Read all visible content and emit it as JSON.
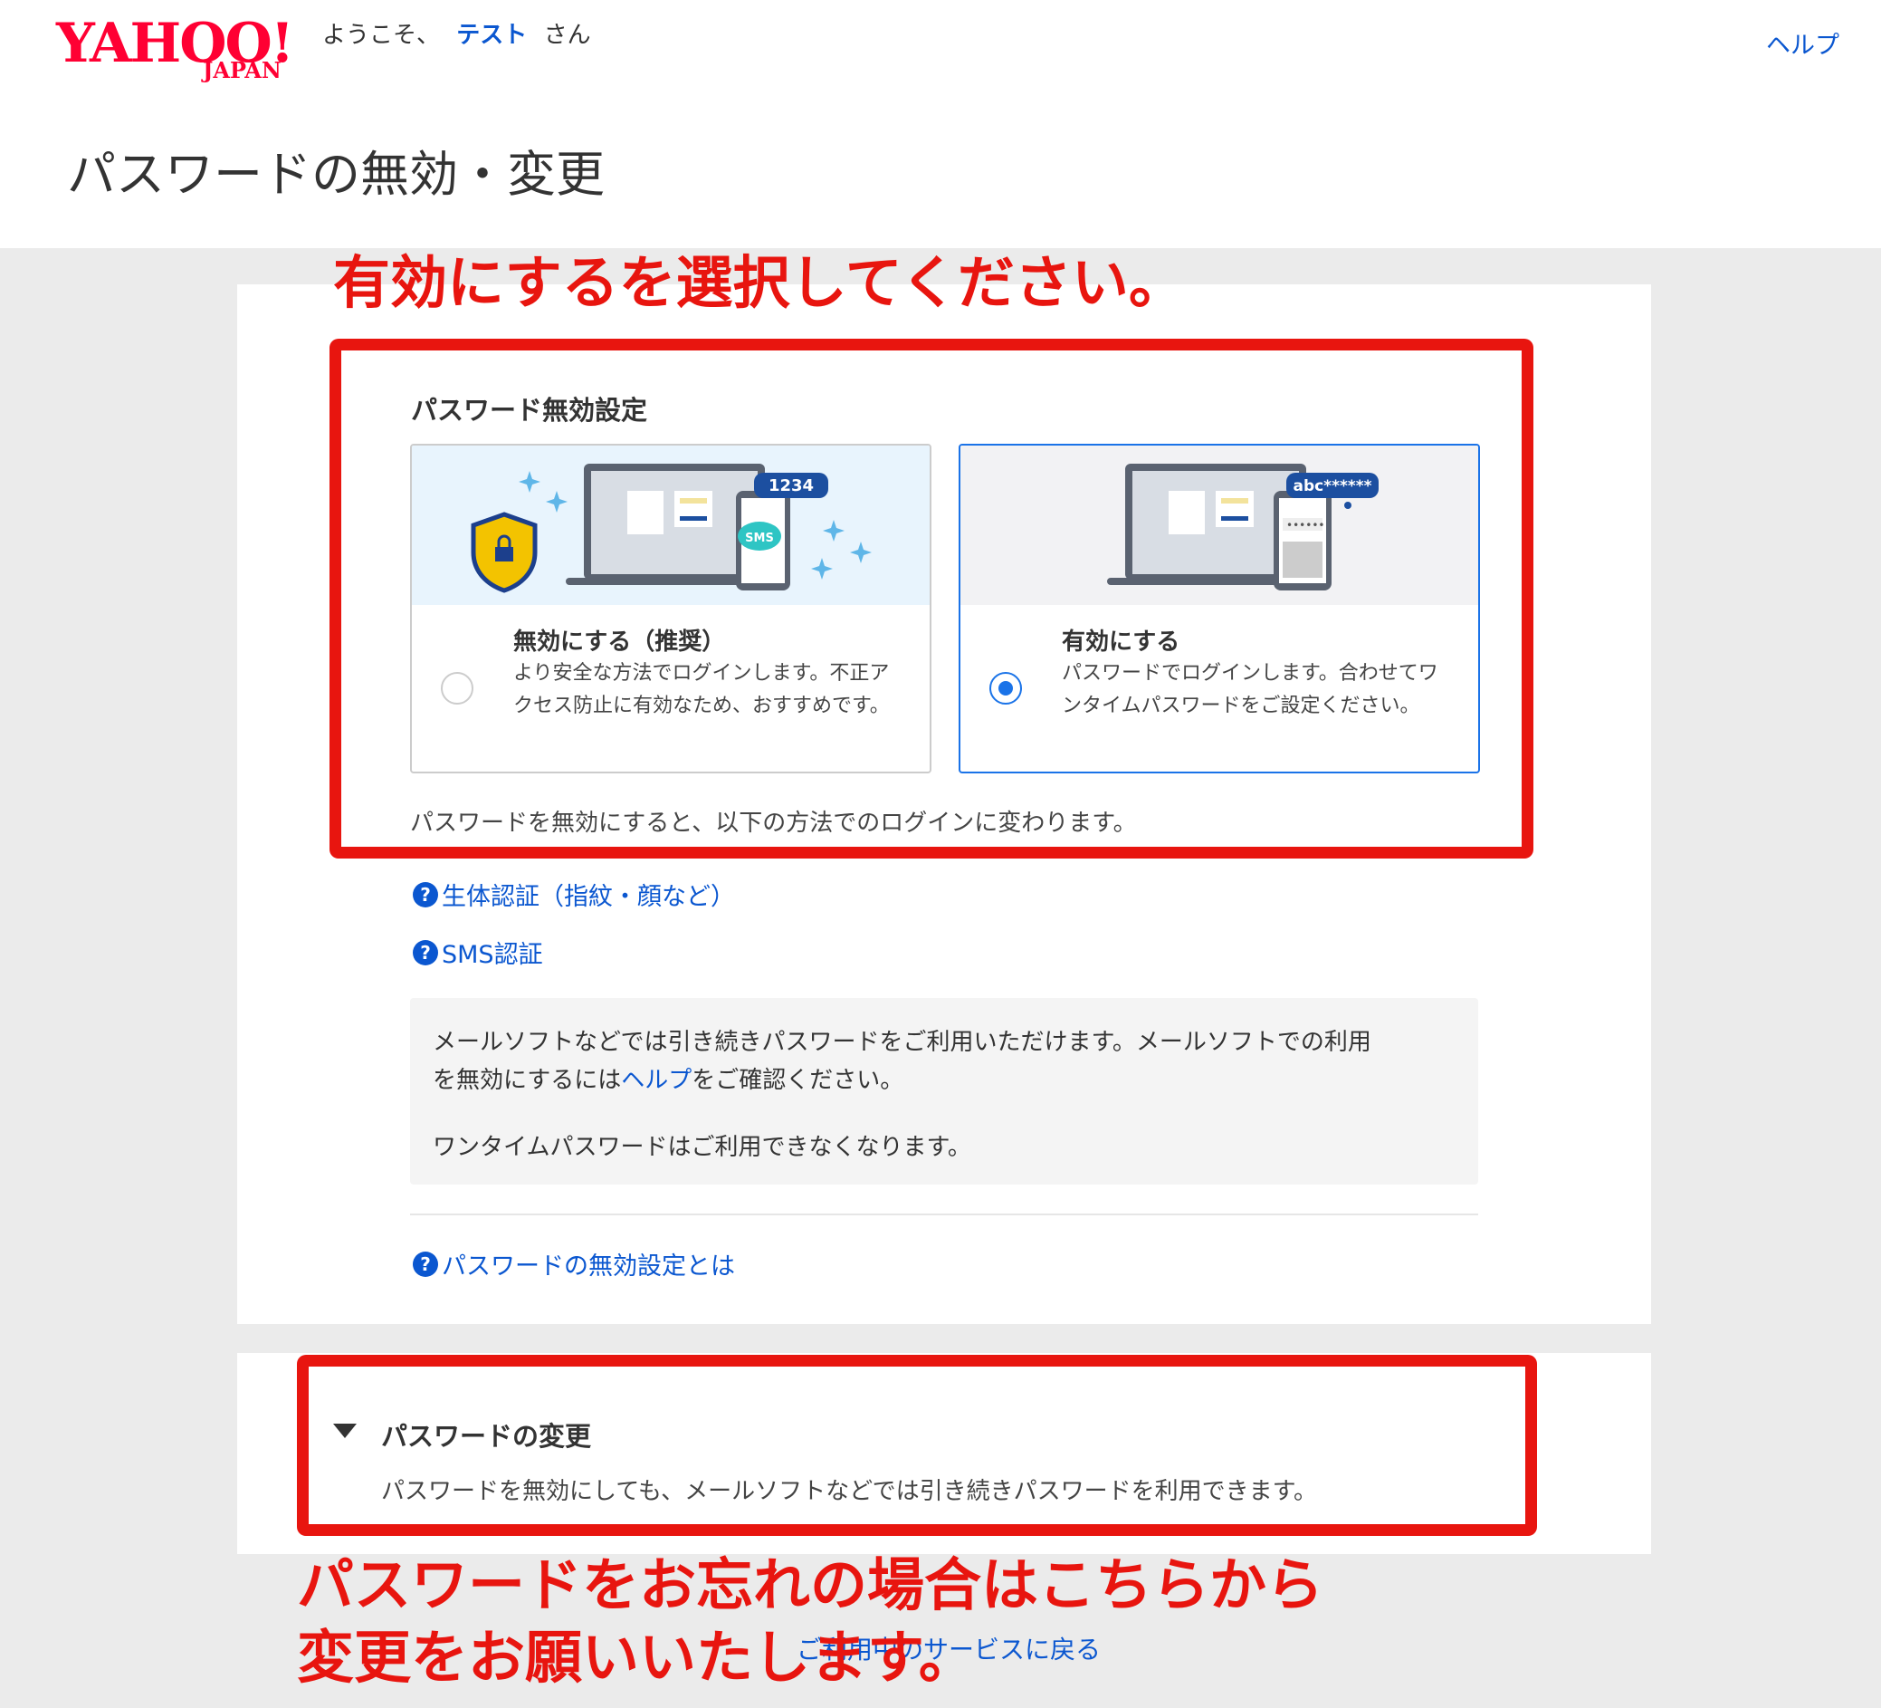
{
  "header": {
    "logo_main": "YAHOO!",
    "logo_sub": "JAPAN",
    "welcome_prefix": "ようこそ、",
    "user_name": "テスト",
    "welcome_suffix": "さん",
    "help_link": "ヘルプ"
  },
  "page_title": "パスワードの無効・変更",
  "password_disable": {
    "heading": "パスワード無効設定",
    "options": [
      {
        "title": "無効にする（推奨）",
        "description": "より安全な方法でログインします。不正アクセス防止に有効なため、おすすめです。",
        "selected": false,
        "illustration_badge": "1234",
        "illustration_bubble": "SMS"
      },
      {
        "title": "有効にする",
        "description": "パスワードでログインします。合わせてワンタイムパスワードをご設定ください。",
        "selected": true,
        "illustration_badge": "abc******"
      }
    ],
    "below_text": "パスワードを無効にすると、以下の方法でのログインに変わります。",
    "methods": [
      "生体認証（指紋・顔など）",
      "SMS認証"
    ],
    "note_line1": "メールソフトなどでは引き続きパスワードをご利用いただけます。メールソフトでの利用",
    "note_line2_prefix": "を無効にするには",
    "note_line2_link": "ヘルプ",
    "note_line2_suffix": "をご確認ください。",
    "note_line3": "ワンタイムパスワードはご利用できなくなります。",
    "about_link": "パスワードの無効設定とは"
  },
  "password_change": {
    "title": "パスワードの変更",
    "description": "パスワードを無効にしても、メールソフトなどでは引き続きパスワードを利用できます。"
  },
  "return_link": "ご利用中のサービスに戻る",
  "annotations": {
    "top": "有効にするを選択してください。",
    "bottom_line1": "パスワードをお忘れの場合はこちらから",
    "bottom_line2": "変更をお願いいたします。",
    "color": "#e8150f"
  },
  "colors": {
    "brand": "#ff0033",
    "link": "#0b57d0",
    "selected": "#1a73e8"
  }
}
